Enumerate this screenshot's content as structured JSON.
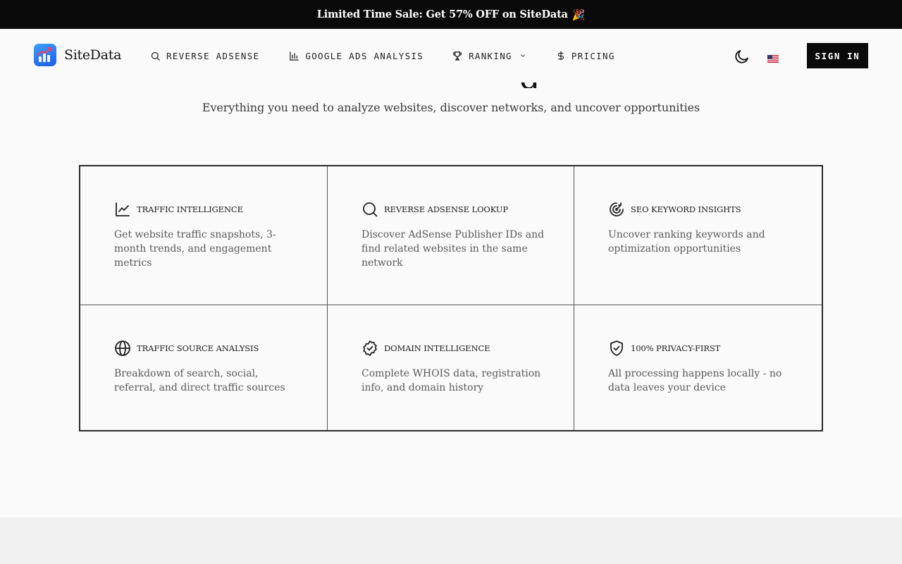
{
  "promo": {
    "text": "Limited Time Sale: Get 57% OFF on SiteData",
    "emoji": "🎉"
  },
  "brand": {
    "name": "SiteData",
    "accent": "#2f7bf5"
  },
  "nav": {
    "items": [
      {
        "label": "REVERSE ADSENSE",
        "icon": "search-icon"
      },
      {
        "label": "GOOGLE ADS ANALYSIS",
        "icon": "bar-chart-icon"
      },
      {
        "label": "RANKING",
        "icon": "trophy-icon",
        "dropdown": true
      },
      {
        "label": "PRICING",
        "icon": "dollar-icon"
      }
    ],
    "signin_label": "SIGN IN"
  },
  "hero": {
    "heading_fragment": "g",
    "subtitle": "Everything you need to analyze websites, discover networks, and uncover opportunities"
  },
  "features": [
    {
      "title": "TRAFFIC INTELLIGENCE",
      "icon": "line-chart-icon",
      "description": "Get website traffic snapshots, 3-month trends, and engagement metrics"
    },
    {
      "title": "REVERSE ADSENSE LOOKUP",
      "icon": "search-icon",
      "description": "Discover AdSense Publisher IDs and find related websites in the same network"
    },
    {
      "title": "SEO KEYWORD INSIGHTS",
      "icon": "target-icon",
      "description": "Uncover ranking keywords and optimization opportunities"
    },
    {
      "title": "TRAFFIC SOURCE ANALYSIS",
      "icon": "globe-icon",
      "description": "Breakdown of search, social, referral, and direct traffic sources"
    },
    {
      "title": "DOMAIN INTELLIGENCE",
      "icon": "badge-check-icon",
      "description": "Complete WHOIS data, registration info, and domain history"
    },
    {
      "title": "100% PRIVACY-FIRST",
      "icon": "shield-check-icon",
      "description": "All processing happens locally - no data leaves your device"
    }
  ]
}
